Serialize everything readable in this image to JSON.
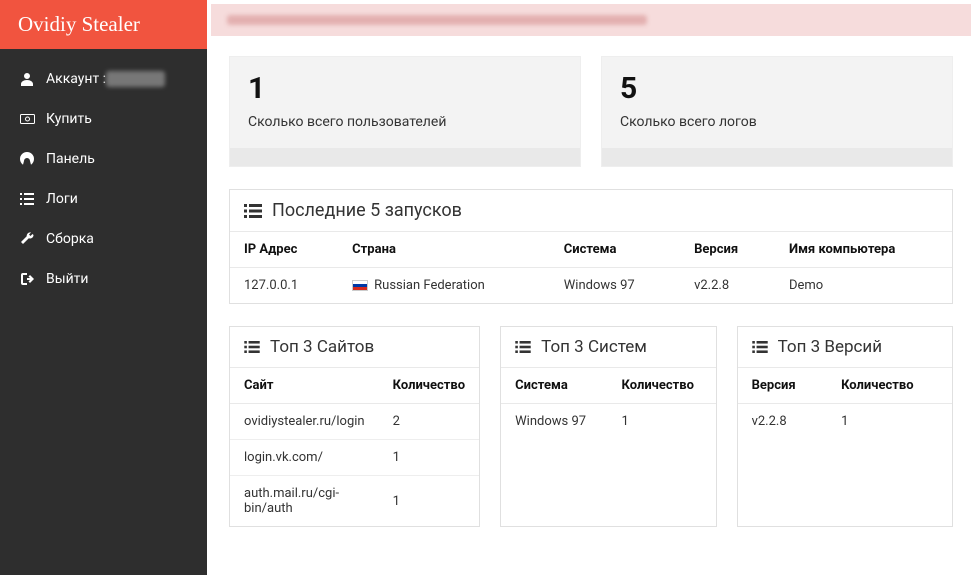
{
  "brand": "Ovidiy Stealer",
  "sidebar": {
    "items": [
      {
        "label": "Аккаунт :",
        "icon": "user-icon",
        "hasBlur": true
      },
      {
        "label": "Купить",
        "icon": "money-icon"
      },
      {
        "label": "Панель",
        "icon": "dashboard-icon"
      },
      {
        "label": "Логи",
        "icon": "list-icon"
      },
      {
        "label": "Сборка",
        "icon": "wrench-icon"
      },
      {
        "label": "Выйти",
        "icon": "signout-icon"
      }
    ]
  },
  "stats": [
    {
      "value": "1",
      "label": "Сколько всего пользователей"
    },
    {
      "value": "5",
      "label": "Сколько всего логов"
    }
  ],
  "lastRuns": {
    "title": "Последние 5 запусков",
    "headers": [
      "IP Адрес",
      "Страна",
      "Система",
      "Версия",
      "Имя компьютера"
    ],
    "rows": [
      {
        "ip": "127.0.0.1",
        "country": "Russian Federation",
        "system": "Windows 97",
        "version": "v2.2.8",
        "computer": "Demo"
      }
    ]
  },
  "topSites": {
    "title": "Топ 3 Сайтов",
    "headers": [
      "Сайт",
      "Количество"
    ],
    "rows": [
      {
        "site": "ovidiystealer.ru/login",
        "count": "2"
      },
      {
        "site": "login.vk.com/",
        "count": "1"
      },
      {
        "site": "auth.mail.ru/cgi-bin/auth",
        "count": "1"
      }
    ]
  },
  "topSystems": {
    "title": "Топ 3 Систем",
    "headers": [
      "Система",
      "Количество"
    ],
    "rows": [
      {
        "system": "Windows 97",
        "count": "1"
      }
    ]
  },
  "topVersions": {
    "title": "Топ 3 Версий",
    "headers": [
      "Версия",
      "Количество"
    ],
    "rows": [
      {
        "version": "v2.2.8",
        "count": "1"
      }
    ]
  }
}
